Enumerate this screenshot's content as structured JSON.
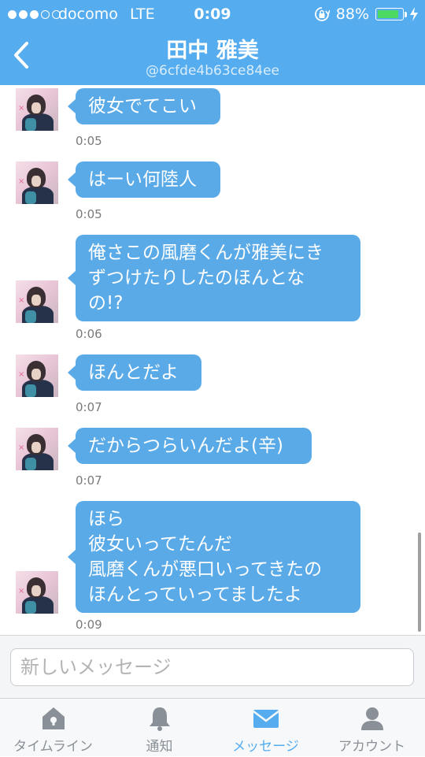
{
  "status_bar": {
    "carrier": "docomo",
    "network": "LTE",
    "time": "0:09",
    "battery_percent": "88%",
    "battery_level": 0.88
  },
  "header": {
    "title": "田中 雅美",
    "handle": "@6cfde4b63ce84ee"
  },
  "messages": [
    {
      "text": "彼女でてこい",
      "time": "0:05"
    },
    {
      "text": "はーい何陸人",
      "time": "0:05"
    },
    {
      "text": "俺さこの風磨くんが雅美にき\nずつけたりしたのほんとな\nの!?",
      "time": "0:06"
    },
    {
      "text": "ほんとだよ",
      "time": "0:07"
    },
    {
      "text": "だからつらいんだよ(辛)",
      "time": "0:07"
    },
    {
      "text": "ほら\n彼女いってたんだ\n風磨くんが悪口いってきたの\nほんとっていってましたよ",
      "time": "0:09"
    }
  ],
  "composer": {
    "placeholder": "新しいメッセージ"
  },
  "tabs": [
    {
      "label": "タイムライン",
      "icon": "home-icon"
    },
    {
      "label": "通知",
      "icon": "bell-icon"
    },
    {
      "label": "メッセージ",
      "icon": "envelope-icon",
      "active": true
    },
    {
      "label": "アカウント",
      "icon": "person-icon"
    }
  ],
  "colors": {
    "brand": "#55acee",
    "bubble": "#5aaae8",
    "battery": "#4cd964"
  }
}
